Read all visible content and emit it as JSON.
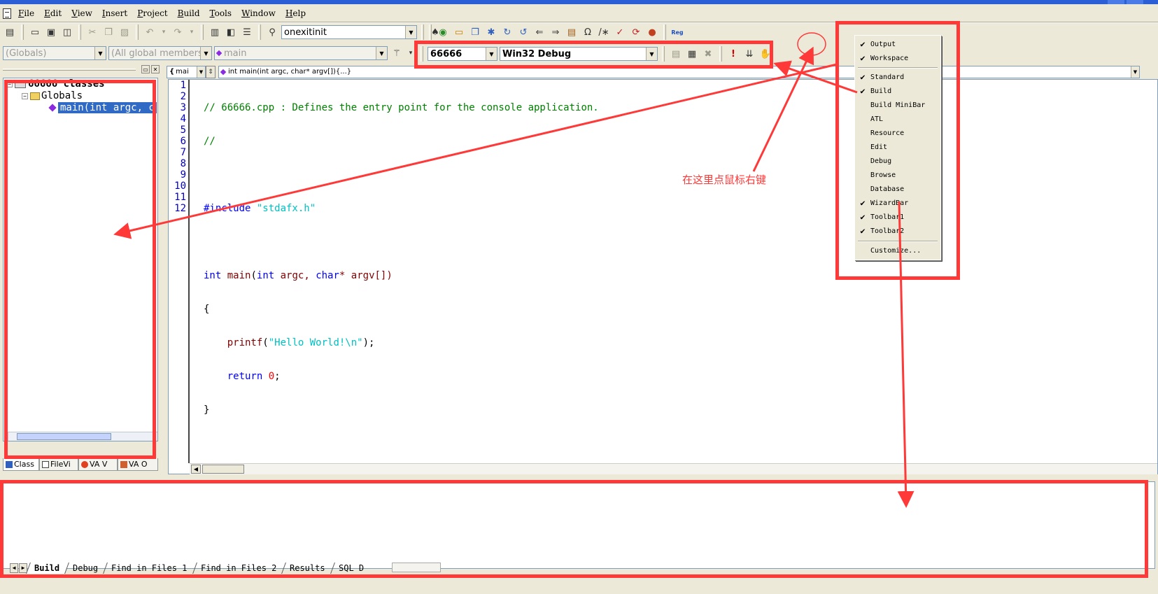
{
  "menubar": {
    "items": [
      "File",
      "Edit",
      "View",
      "Insert",
      "Project",
      "Build",
      "Tools",
      "Window",
      "Help"
    ]
  },
  "standard_toolbar": {
    "find_combo_value": "onexitinit",
    "button_icons": [
      "new-text-file-icon",
      "open-folder-icon",
      "save-icon",
      "save-all-icon",
      "cut-icon",
      "copy-icon",
      "paste-icon",
      "undo-icon",
      "redo-icon",
      "workspace-icon",
      "output-window-icon",
      "window-list-icon",
      "find-in-files-icon",
      "search-icon"
    ]
  },
  "toolbar2": {
    "label": "Reg"
  },
  "wizardbar": {
    "class_combo": "(Globals)",
    "filter_combo": "(All global members",
    "members_combo": "main"
  },
  "build_toolbar": {
    "project_combo": "66666",
    "config_combo": "Win32 Debug"
  },
  "workspace": {
    "root_label": "66666 classes",
    "folder_label": "Globals",
    "selected_item": "main(int argc, c",
    "tabs": [
      "Class",
      "FileVi",
      "VA V",
      "VA O"
    ]
  },
  "editor": {
    "scope_combo": "mai",
    "function_combo": "int main(int argc, char* argv[]){...}",
    "line_numbers": [
      "1",
      "2",
      "3",
      "4",
      "5",
      "6",
      "7",
      "8",
      "9",
      "10",
      "11",
      "12"
    ],
    "lines": {
      "l1": "// 66666.cpp : Defines the entry point for the console application.",
      "l2": "//",
      "l4_directive": "#include ",
      "l4_string": "\"stdafx.h\"",
      "l6_kw1": "int",
      "l6_fn": " main",
      "l6_p1": "(",
      "l6_kw2": "int",
      "l6_p2": " argc, ",
      "l6_kw3": "char",
      "l6_p3": "* argv[])",
      "l7": "{",
      "l8_indent": "    ",
      "l8_fn": "printf",
      "l8_p1": "(",
      "l8_str": "\"Hello World!\\n\"",
      "l8_p2": ");",
      "l9_indent": "    ",
      "l9_kw": "return",
      "l9_num": " 0",
      "l9_p": ";",
      "l10": "}"
    }
  },
  "output": {
    "tabs": [
      "Build",
      "Debug",
      "Find in Files 1",
      "Find in Files 2",
      "Results",
      "SQL D"
    ]
  },
  "context_menu": {
    "items": [
      {
        "label": "Output",
        "checked": true
      },
      {
        "label": "Workspace",
        "checked": true
      },
      {
        "label": "Standard",
        "checked": true
      },
      {
        "label": "Build",
        "checked": true
      },
      {
        "label": "Build MiniBar",
        "checked": false
      },
      {
        "label": "ATL",
        "checked": false
      },
      {
        "label": "Resource",
        "checked": false
      },
      {
        "label": "Edit",
        "checked": false
      },
      {
        "label": "Debug",
        "checked": false
      },
      {
        "label": "Browse",
        "checked": false
      },
      {
        "label": "Database",
        "checked": false
      },
      {
        "label": "WizardBar",
        "checked": true
      },
      {
        "label": "Toolbar1",
        "checked": true
      },
      {
        "label": "Toolbar2",
        "checked": true
      },
      {
        "label": "Customize...",
        "checked": false
      }
    ]
  },
  "annotation": {
    "note": "在这里点鼠标右键",
    "color": "#ff3838"
  },
  "colors": {
    "chrome": "#ece9d8",
    "selection": "#316ac5",
    "comment": "#008000",
    "keyword": "#0000ff",
    "string": "#00c0c0"
  }
}
